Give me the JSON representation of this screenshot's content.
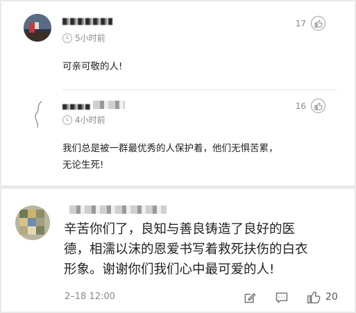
{
  "comment1": {
    "time": "5小时前",
    "likes": "17",
    "text": "可亲可敬的人!"
  },
  "comment2": {
    "time": "4小时前",
    "likes": "16",
    "text_line1": "我们总是被一群最优秀的人保护着，他们无惧苦累，",
    "text_line2": "无论生死!"
  },
  "comment3": {
    "text_line1": "辛苦你们了，良知与善良铸造了良好的医",
    "text_line2": "德，相濡以沫的恩爱书写着救死扶伤的白衣",
    "text_line3": "形象。谢谢你们我们心中最可爱的人!",
    "date": "2–18 12:00",
    "likes": "20"
  },
  "icons": [
    "clock-icon",
    "thumbs-up-icon",
    "edit-icon",
    "reply-icon"
  ]
}
